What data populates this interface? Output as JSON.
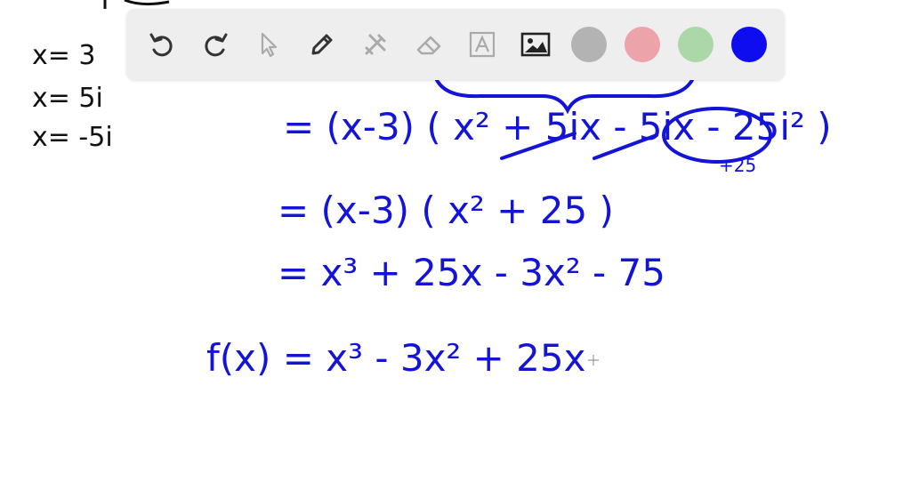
{
  "notes": {
    "roots": [
      "x= 3",
      "x= 5i",
      "x= -5i"
    ],
    "line_equal_1": "= (x-3) ( x² + 5ix - 5ix - 25i² )",
    "annotation_plus25": "+25",
    "line_equal_2": "= (x-3) ( x² + 25 )",
    "line_equal_3": "= x³ + 25x - 3x² - 75",
    "final_function": "f(x) =  x³ - 3x² + 25x"
  },
  "toolbar": {
    "tools": [
      {
        "icon": "undo-icon"
      },
      {
        "icon": "redo-icon"
      },
      {
        "icon": "select-arrow-icon"
      },
      {
        "icon": "pen-icon"
      },
      {
        "icon": "tools-icon"
      },
      {
        "icon": "eraser-icon"
      },
      {
        "icon": "text-icon"
      },
      {
        "icon": "image-icon"
      }
    ],
    "colors": [
      "#b3b3b3",
      "#eca3aa",
      "#abd7a9",
      "#0d0df0"
    ],
    "selected_color": "#0d0df0"
  }
}
